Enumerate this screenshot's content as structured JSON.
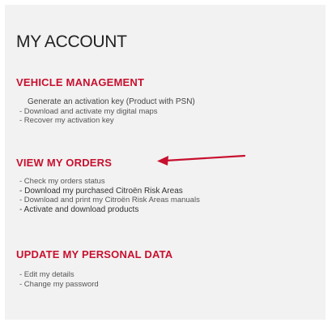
{
  "title": "MY ACCOUNT",
  "sections": [
    {
      "heading": "VEHICLE MANAGEMENT",
      "items": [
        "Generate an activation key (Product with PSN)",
        "- Download and activate my digital maps",
        "- Recover my activation key"
      ]
    },
    {
      "heading": "VIEW MY ORDERS",
      "items": [
        "- Check my orders status",
        "- Download my purchased Citroën Risk Areas",
        "- Download and print my Citroën Risk Areas manuals",
        "- Activate and download products"
      ]
    },
    {
      "heading": "UPDATE MY PERSONAL DATA",
      "items": [
        "- Edit my details",
        "- Change my password"
      ]
    }
  ],
  "annotation": {
    "arrow_color": "#c8102e",
    "icon": "red-arrow-icon"
  },
  "colors": {
    "heading": "#c8102e",
    "panel_bg": "#f2f2f2"
  }
}
